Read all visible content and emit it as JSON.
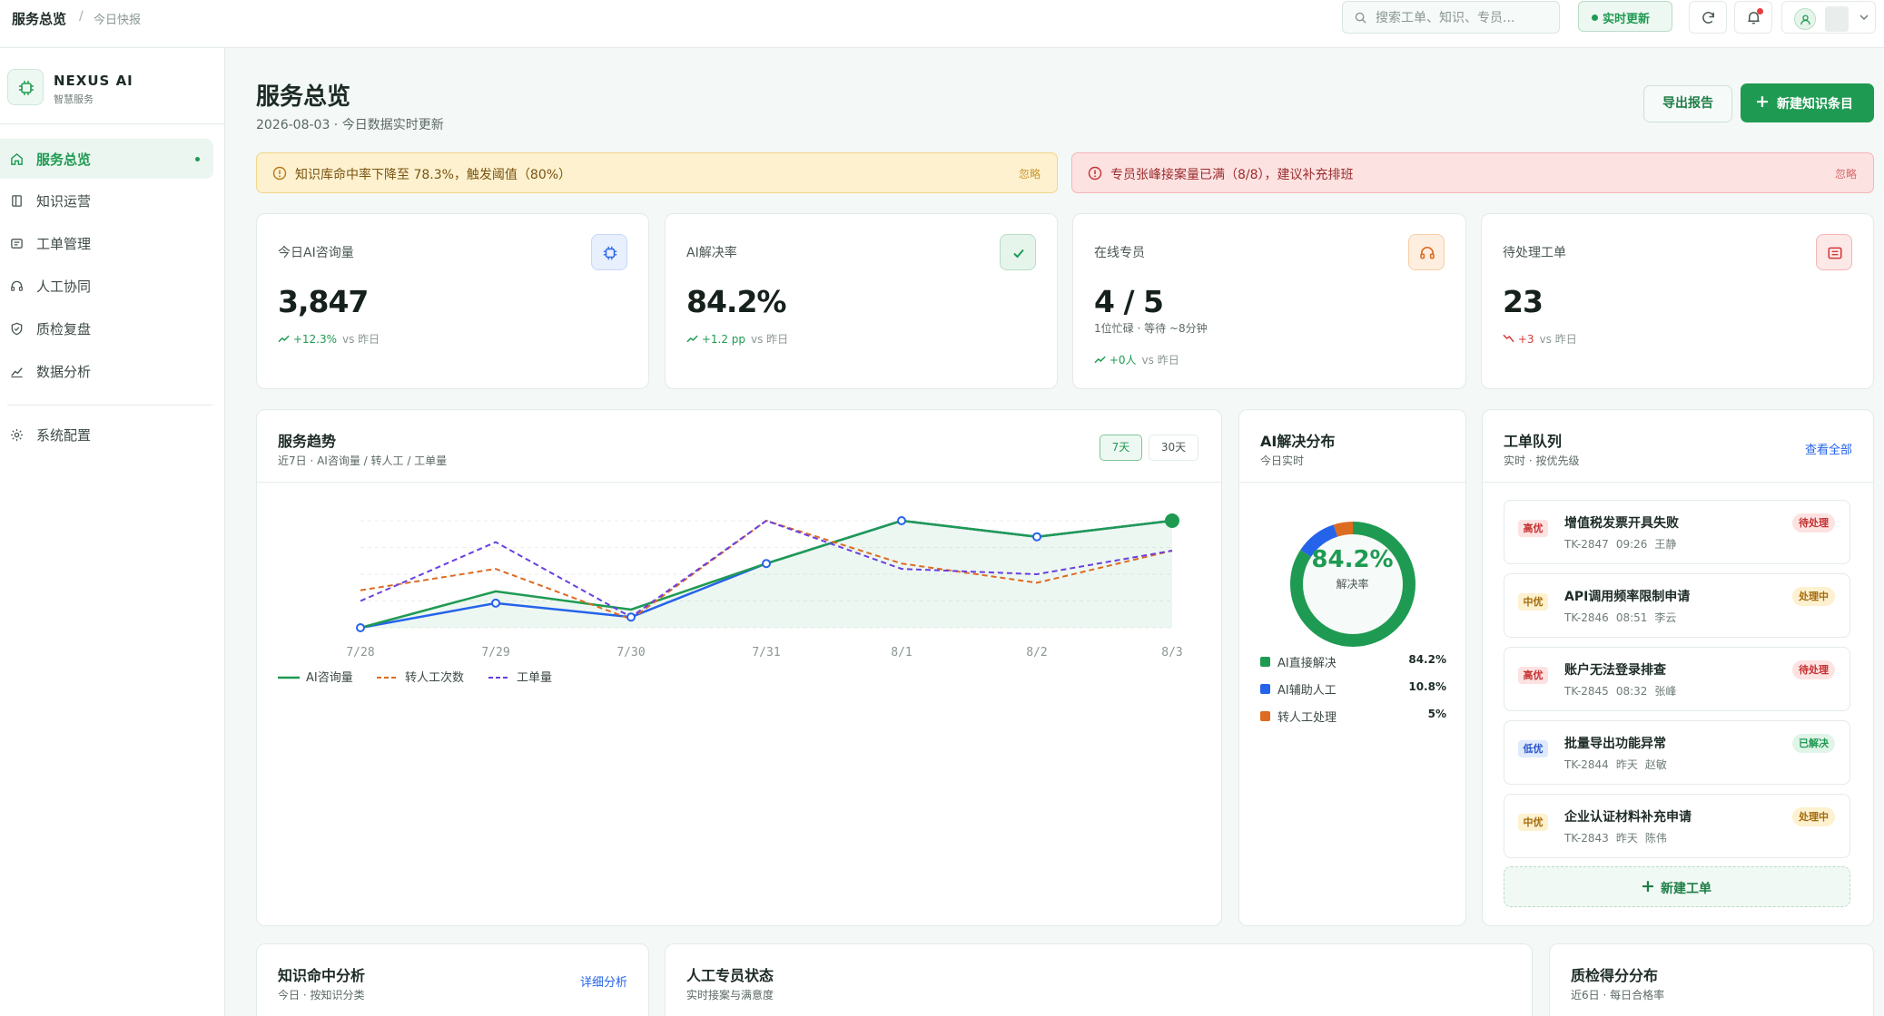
{
  "topbar": {
    "breadcrumb": "服务总览",
    "breadcrumb_sep": "/",
    "breadcrumb_sub": "今日快报",
    "search_placeholder": "搜索工单、知识、专员...",
    "live_label": "实时更新"
  },
  "sidebar": {
    "brand_name": "NEXUS AI",
    "brand_sub": "智慧服务",
    "items": [
      {
        "label": "服务总览",
        "icon": "home-icon",
        "active": true
      },
      {
        "label": "知识运营",
        "icon": "book-icon"
      },
      {
        "label": "工单管理",
        "icon": "ticket-icon"
      },
      {
        "label": "人工协同",
        "icon": "headset-icon"
      },
      {
        "label": "质检复盘",
        "icon": "shield-icon"
      },
      {
        "label": "数据分析",
        "icon": "chart-icon"
      },
      {
        "label": "系统配置",
        "icon": "gear-icon"
      }
    ]
  },
  "header": {
    "title": "服务总览",
    "subtitle": "2026-08-03 · 今日数据实时更新",
    "export_label": "导出报告",
    "new_label": "新建知识条目"
  },
  "alerts": [
    {
      "type": "warning",
      "message": "知识库命中率下降至 78.3%，触发阈值（80%）",
      "dismiss": "忽略"
    },
    {
      "type": "error",
      "message": "专员张峰接案量已满（8/8），建议补充排班",
      "dismiss": "忽略"
    }
  ],
  "stats": [
    {
      "label": "今日AI咨询量",
      "value": "3,847",
      "trend": "+12.3%",
      "compare": "vs 昨日",
      "direction": "up",
      "icon": "chip-icon",
      "color": "#2563eb"
    },
    {
      "label": "AI解决率",
      "value": "84.2%",
      "trend": "+1.2 pp",
      "compare": "vs 昨日",
      "direction": "up",
      "icon": "check-icon",
      "color": "#1f9a52"
    },
    {
      "label": "在线专员",
      "value": "4 / 5",
      "extra": "1位忙碌 · 等待 ~8分钟",
      "trend": "+0人",
      "compare": "vs 昨日",
      "direction": "up",
      "icon": "headset-icon",
      "color": "#dd6b20"
    },
    {
      "label": "待处理工单",
      "value": "23",
      "trend": "+3",
      "compare": "vs 昨日",
      "direction": "down",
      "icon": "list-icon",
      "color": "#d43a3a"
    }
  ],
  "trend_card": {
    "title": "服务趋势",
    "subtitle": "近7日 · AI咨询量 / 转人工 / 工单量",
    "range_options": [
      "7天",
      "30天"
    ]
  },
  "chart_data": {
    "type": "line",
    "x": [
      "7/28",
      "7/29",
      "7/30",
      "7/31",
      "8/1",
      "8/2",
      "8/3"
    ],
    "series": [
      {
        "name": "AI咨询量",
        "color": "#1f9a52",
        "style": "solid-area",
        "values": [
          0.0,
          0.34,
          0.17,
          0.6,
          1.0,
          0.85,
          1.0
        ]
      },
      {
        "name": "转人工次数",
        "color": "#dd6b20",
        "style": "dashed",
        "values": [
          0.35,
          0.55,
          0.08,
          1.0,
          0.6,
          0.42,
          0.72
        ]
      },
      {
        "name": "工单量",
        "color": "#6a3fe0",
        "style": "dashed",
        "values": [
          0.25,
          0.8,
          0.1,
          1.0,
          0.55,
          0.5,
          0.72
        ]
      }
    ],
    "extra_marked_series": {
      "color": "#2563eb",
      "values": [
        0.0,
        0.23,
        0.1,
        0.6,
        1.0,
        0.85,
        1.0
      ]
    },
    "grid": true,
    "legend": "bottom-left"
  },
  "dist_card": {
    "title": "AI解决分布",
    "subtitle": "今日实时",
    "center_value": "84.2%",
    "center_label": "解决率",
    "items": [
      {
        "name": "AI直接解决",
        "percent": "84.2%",
        "value": 84.2,
        "color": "#1f9a52"
      },
      {
        "name": "AI辅助人工",
        "percent": "10.8%",
        "value": 10.8,
        "color": "#2563eb"
      },
      {
        "name": "转人工处理",
        "percent": "5%",
        "value": 5,
        "color": "#dd6b20"
      }
    ]
  },
  "queue_card": {
    "title": "工单队列",
    "subtitle": "实时 · 按优先级",
    "view_all": "查看全部",
    "new_ticket": "新建工单",
    "tickets": [
      {
        "priority": "高优",
        "level": "high",
        "title": "增值税发票开具失败",
        "id": "TK-2847",
        "time": "09:26",
        "owner": "王静",
        "status": "待处理",
        "state": "pending"
      },
      {
        "priority": "中优",
        "level": "mid",
        "title": "API调用频率限制申请",
        "id": "TK-2846",
        "time": "08:51",
        "owner": "李云",
        "status": "处理中",
        "state": "doing"
      },
      {
        "priority": "高优",
        "level": "high",
        "title": "账户无法登录排查",
        "id": "TK-2845",
        "time": "08:32",
        "owner": "张峰",
        "status": "待处理",
        "state": "pending"
      },
      {
        "priority": "低优",
        "level": "low",
        "title": "批量导出功能异常",
        "id": "TK-2844",
        "time": "昨天",
        "owner": "赵敏",
        "status": "已解决",
        "state": "done"
      },
      {
        "priority": "中优",
        "level": "mid",
        "title": "企业认证材料补充申请",
        "id": "TK-2843",
        "time": "昨天",
        "owner": "陈伟",
        "status": "处理中",
        "state": "doing"
      }
    ]
  },
  "bottom_cards": [
    {
      "title": "知识命中分析",
      "subtitle": "今日 · 按知识分类",
      "link": "详细分析"
    },
    {
      "title": "人工专员状态",
      "subtitle": "实时接案与满意度"
    },
    {
      "title": "质检得分分布",
      "subtitle": "近6日 · 每日合格率"
    }
  ]
}
